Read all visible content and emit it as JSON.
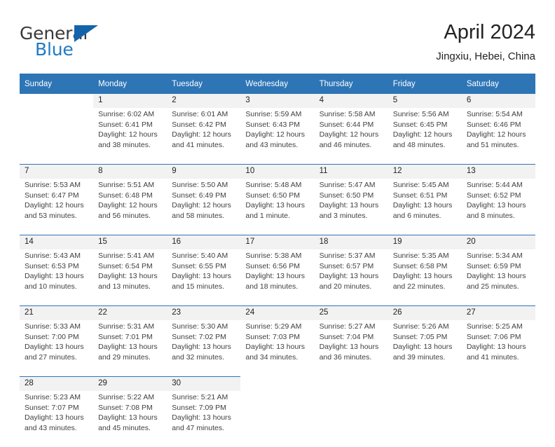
{
  "brand": {
    "name_part1": "General",
    "name_part2": "Blue",
    "flag_icon": "triangle-flag-icon"
  },
  "header": {
    "title": "April 2024",
    "location": "Jingxiu, Hebei, China"
  },
  "calendar": {
    "weekday_headers": [
      "Sunday",
      "Monday",
      "Tuesday",
      "Wednesday",
      "Thursday",
      "Friday",
      "Saturday"
    ],
    "accent_color": "#2e75b6",
    "daynum_band_color": "#f2f2f2",
    "weeks": [
      [
        {
          "day": "",
          "lines": []
        },
        {
          "day": "1",
          "lines": [
            "Sunrise: 6:02 AM",
            "Sunset: 6:41 PM",
            "Daylight: 12 hours",
            "and 38 minutes."
          ]
        },
        {
          "day": "2",
          "lines": [
            "Sunrise: 6:01 AM",
            "Sunset: 6:42 PM",
            "Daylight: 12 hours",
            "and 41 minutes."
          ]
        },
        {
          "day": "3",
          "lines": [
            "Sunrise: 5:59 AM",
            "Sunset: 6:43 PM",
            "Daylight: 12 hours",
            "and 43 minutes."
          ]
        },
        {
          "day": "4",
          "lines": [
            "Sunrise: 5:58 AM",
            "Sunset: 6:44 PM",
            "Daylight: 12 hours",
            "and 46 minutes."
          ]
        },
        {
          "day": "5",
          "lines": [
            "Sunrise: 5:56 AM",
            "Sunset: 6:45 PM",
            "Daylight: 12 hours",
            "and 48 minutes."
          ]
        },
        {
          "day": "6",
          "lines": [
            "Sunrise: 5:54 AM",
            "Sunset: 6:46 PM",
            "Daylight: 12 hours",
            "and 51 minutes."
          ]
        }
      ],
      [
        {
          "day": "7",
          "lines": [
            "Sunrise: 5:53 AM",
            "Sunset: 6:47 PM",
            "Daylight: 12 hours",
            "and 53 minutes."
          ]
        },
        {
          "day": "8",
          "lines": [
            "Sunrise: 5:51 AM",
            "Sunset: 6:48 PM",
            "Daylight: 12 hours",
            "and 56 minutes."
          ]
        },
        {
          "day": "9",
          "lines": [
            "Sunrise: 5:50 AM",
            "Sunset: 6:49 PM",
            "Daylight: 12 hours",
            "and 58 minutes."
          ]
        },
        {
          "day": "10",
          "lines": [
            "Sunrise: 5:48 AM",
            "Sunset: 6:50 PM",
            "Daylight: 13 hours",
            "and 1 minute."
          ]
        },
        {
          "day": "11",
          "lines": [
            "Sunrise: 5:47 AM",
            "Sunset: 6:50 PM",
            "Daylight: 13 hours",
            "and 3 minutes."
          ]
        },
        {
          "day": "12",
          "lines": [
            "Sunrise: 5:45 AM",
            "Sunset: 6:51 PM",
            "Daylight: 13 hours",
            "and 6 minutes."
          ]
        },
        {
          "day": "13",
          "lines": [
            "Sunrise: 5:44 AM",
            "Sunset: 6:52 PM",
            "Daylight: 13 hours",
            "and 8 minutes."
          ]
        }
      ],
      [
        {
          "day": "14",
          "lines": [
            "Sunrise: 5:43 AM",
            "Sunset: 6:53 PM",
            "Daylight: 13 hours",
            "and 10 minutes."
          ]
        },
        {
          "day": "15",
          "lines": [
            "Sunrise: 5:41 AM",
            "Sunset: 6:54 PM",
            "Daylight: 13 hours",
            "and 13 minutes."
          ]
        },
        {
          "day": "16",
          "lines": [
            "Sunrise: 5:40 AM",
            "Sunset: 6:55 PM",
            "Daylight: 13 hours",
            "and 15 minutes."
          ]
        },
        {
          "day": "17",
          "lines": [
            "Sunrise: 5:38 AM",
            "Sunset: 6:56 PM",
            "Daylight: 13 hours",
            "and 18 minutes."
          ]
        },
        {
          "day": "18",
          "lines": [
            "Sunrise: 5:37 AM",
            "Sunset: 6:57 PM",
            "Daylight: 13 hours",
            "and 20 minutes."
          ]
        },
        {
          "day": "19",
          "lines": [
            "Sunrise: 5:35 AM",
            "Sunset: 6:58 PM",
            "Daylight: 13 hours",
            "and 22 minutes."
          ]
        },
        {
          "day": "20",
          "lines": [
            "Sunrise: 5:34 AM",
            "Sunset: 6:59 PM",
            "Daylight: 13 hours",
            "and 25 minutes."
          ]
        }
      ],
      [
        {
          "day": "21",
          "lines": [
            "Sunrise: 5:33 AM",
            "Sunset: 7:00 PM",
            "Daylight: 13 hours",
            "and 27 minutes."
          ]
        },
        {
          "day": "22",
          "lines": [
            "Sunrise: 5:31 AM",
            "Sunset: 7:01 PM",
            "Daylight: 13 hours",
            "and 29 minutes."
          ]
        },
        {
          "day": "23",
          "lines": [
            "Sunrise: 5:30 AM",
            "Sunset: 7:02 PM",
            "Daylight: 13 hours",
            "and 32 minutes."
          ]
        },
        {
          "day": "24",
          "lines": [
            "Sunrise: 5:29 AM",
            "Sunset: 7:03 PM",
            "Daylight: 13 hours",
            "and 34 minutes."
          ]
        },
        {
          "day": "25",
          "lines": [
            "Sunrise: 5:27 AM",
            "Sunset: 7:04 PM",
            "Daylight: 13 hours",
            "and 36 minutes."
          ]
        },
        {
          "day": "26",
          "lines": [
            "Sunrise: 5:26 AM",
            "Sunset: 7:05 PM",
            "Daylight: 13 hours",
            "and 39 minutes."
          ]
        },
        {
          "day": "27",
          "lines": [
            "Sunrise: 5:25 AM",
            "Sunset: 7:06 PM",
            "Daylight: 13 hours",
            "and 41 minutes."
          ]
        }
      ],
      [
        {
          "day": "28",
          "lines": [
            "Sunrise: 5:23 AM",
            "Sunset: 7:07 PM",
            "Daylight: 13 hours",
            "and 43 minutes."
          ]
        },
        {
          "day": "29",
          "lines": [
            "Sunrise: 5:22 AM",
            "Sunset: 7:08 PM",
            "Daylight: 13 hours",
            "and 45 minutes."
          ]
        },
        {
          "day": "30",
          "lines": [
            "Sunrise: 5:21 AM",
            "Sunset: 7:09 PM",
            "Daylight: 13 hours",
            "and 47 minutes."
          ]
        },
        {
          "day": "",
          "lines": []
        },
        {
          "day": "",
          "lines": []
        },
        {
          "day": "",
          "lines": []
        },
        {
          "day": "",
          "lines": []
        }
      ]
    ]
  }
}
